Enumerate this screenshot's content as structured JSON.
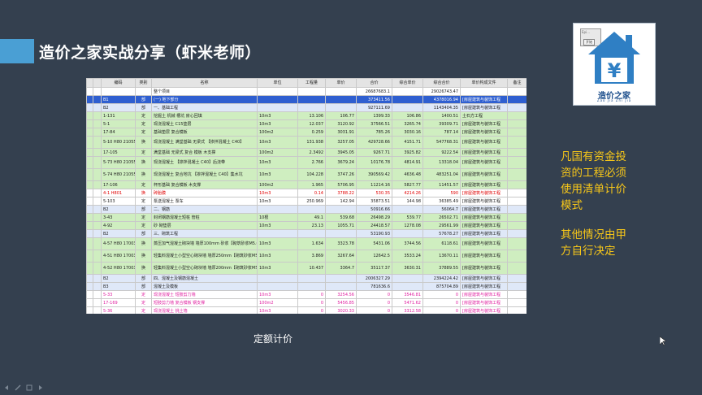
{
  "header": {
    "title": "造价之家实战分享（虾米老师）"
  },
  "table": {
    "columns": [
      "编码",
      "类别",
      "名称",
      "单位",
      "工程量",
      "单价",
      "合价",
      "综合单价",
      "综合合价",
      "单价构成文件",
      "备注"
    ],
    "rows": [
      {
        "cls": "row-white",
        "cells": [
          "",
          "",
          "整个项目",
          "",
          "",
          "",
          "26687683.1",
          "",
          "29026743.47",
          "",
          ""
        ]
      },
      {
        "cls": "row-blue",
        "cells": [
          "B1",
          "部",
          "(一) 地下部分",
          "",
          "",
          "",
          "373411.56",
          "",
          "4378016.94",
          "[房屋建筑与装饰工程",
          ""
        ]
      },
      {
        "cls": "row-lblue",
        "cells": [
          "B2",
          "部",
          "一、基础工程",
          "",
          "",
          "",
          "927111.69",
          "",
          "1143404.35",
          "[房屋建筑与装饰工程",
          ""
        ]
      },
      {
        "cls": "row-green",
        "cells": [
          "1-131",
          "定",
          "挖掘土 机械 槽坑 房心回填",
          "10m3",
          "13.106",
          "106.77",
          "1399.33",
          "106.86",
          "1400.51",
          "土石方工程",
          ""
        ]
      },
      {
        "cls": "row-green",
        "cells": [
          "5-1",
          "定",
          "现浇混凝土 C15垫层",
          "10m3",
          "12.037",
          "3120.92",
          "37566.51",
          "3265.74",
          "39309.71",
          "[房屋建筑与装饰工程",
          ""
        ]
      },
      {
        "cls": "row-green",
        "cells": [
          "17-84",
          "定",
          "基础垫层 复合模板",
          "100m2",
          "0.259",
          "3031.91",
          "785.26",
          "3030.16",
          "787.14",
          "[房屋建筑与装饰工程",
          ""
        ]
      },
      {
        "cls": "row-green row-tall",
        "cells": [
          "5-10 H80 210557 8",
          "换",
          "现浇混凝土 满堂基础 无梁式 【掺拌混凝土 C40】",
          "10m3",
          "131.938",
          "3257.05",
          "429728.66",
          "4151.71",
          "547768.31",
          "[房屋建筑与装饰工程",
          ""
        ]
      },
      {
        "cls": "row-green",
        "cells": [
          "17-105",
          "定",
          "满堂基础 无梁式 复合 模板 木支撑",
          "100m2",
          "2.3492",
          "3945.05",
          "9267.71",
          "3925.82",
          "9222.54",
          "[房屋建筑与装饰工程",
          ""
        ]
      },
      {
        "cls": "row-green row-tall",
        "cells": [
          "5-73 H80 210557 8",
          "换",
          "现浇混凝土 【掺拌混凝土 C40】后浇带",
          "10m3",
          "2.766",
          "3679.24",
          "10176.78",
          "4814.91",
          "13318.04",
          "[房屋建筑与装饰工程",
          ""
        ]
      },
      {
        "cls": "row-green row-tall",
        "cells": [
          "5-74 H80 210557 8",
          "换",
          "现浇混凝土 复合地坑 【掺拌混凝土 C40】集水坑",
          "10m3",
          "104.228",
          "3747.26",
          "390569.42",
          "4636.48",
          "483251.04",
          "[房屋建筑与装饰工程",
          ""
        ]
      },
      {
        "cls": "row-green",
        "cells": [
          "17-106",
          "定",
          "杯形基础 复合模板 木支撑",
          "100m2",
          "1.965",
          "5706.95",
          "11214.16",
          "5827.77",
          "11451.57",
          "[房屋建筑与装饰工程",
          ""
        ]
      },
      {
        "cls": "row-red",
        "cells": [
          "4-1 H801",
          "换",
          "砖胎膜",
          "10m3",
          "0.14",
          "3788.22",
          "530.35",
          "4214.26",
          "590",
          "[房屋建筑与装饰工程",
          ""
        ]
      },
      {
        "cls": "row-white",
        "cells": [
          "5-103",
          "定",
          "泵送混凝土 泵车",
          "10m3",
          "250.969",
          "142.94",
          "35873.51",
          "144.98",
          "36385.49",
          "[房屋建筑与装饰工程",
          ""
        ]
      },
      {
        "cls": "row-lblue",
        "cells": [
          "B2",
          "部",
          "二、钢筋",
          "",
          "",
          "",
          "50916.66",
          "",
          "56064.7",
          "[房屋建筑与装饰工程",
          ""
        ]
      },
      {
        "cls": "row-green",
        "cells": [
          "3-43",
          "定",
          "封闭钢筋混凝土短桩 管桩",
          "10根",
          "49.1",
          "539.68",
          "26498.29",
          "539.77",
          "26502.71",
          "[房屋建筑与装饰工程",
          ""
        ]
      },
      {
        "cls": "row-green",
        "cells": [
          "4-92",
          "定",
          "砂 砌垫层",
          "10m3",
          "23.13",
          "1055.71",
          "24418.57",
          "1278.08",
          "29561.99",
          "[房屋建筑与装饰工程",
          ""
        ]
      },
      {
        "cls": "row-lblue",
        "cells": [
          "B2",
          "部",
          "三、砌筑工程",
          "",
          "",
          "",
          "53190.93",
          "",
          "57678.27",
          "[房屋建筑与装饰工程",
          ""
        ]
      },
      {
        "cls": "row-green row-tall",
        "cells": [
          "4-57 H80 170030 8",
          "换",
          "蒸压加气混凝土砌块墙 墙厚100mm 砂浆【砌筑砂浆M5.0】",
          "10m3",
          "1.634",
          "3323.78",
          "5431.06",
          "3744.56",
          "6118.61",
          "[房屋建筑与装饰工程",
          ""
        ]
      },
      {
        "cls": "row-green row-tall",
        "cells": [
          "4-51 H80 170030 8",
          "换",
          "轻集料混凝土小型空心砌块墙 墙厚250mm【砌筑砂浆M5.0】",
          "10m3",
          "3.869",
          "3267.64",
          "12642.5",
          "3533.24",
          "13670.11",
          "[房屋建筑与装饰工程",
          ""
        ]
      },
      {
        "cls": "row-green row-tall",
        "cells": [
          "4-52 H80 170030 8",
          "换",
          "轻集料混凝土小型空心砌块墙 墙厚200mm【砌筑砂浆M5.0】",
          "10m3",
          "10.437",
          "3364.7",
          "35117.37",
          "3630.31",
          "37889.55",
          "[房屋建筑与装饰工程",
          ""
        ]
      },
      {
        "cls": "row-lblue",
        "cells": [
          "B2",
          "部",
          "四、混凝土及钢筋混凝土",
          "",
          "",
          "",
          "2006327.29",
          "",
          "2394224.42",
          "[房屋建筑与装饰工程",
          ""
        ]
      },
      {
        "cls": "row-lblue",
        "cells": [
          "B3",
          "部",
          "混凝土及模板",
          "",
          "",
          "",
          "781636.6",
          "",
          "875704.89",
          "[房屋建筑与装饰工程",
          ""
        ]
      },
      {
        "cls": "row-pink",
        "cells": [
          "5-33",
          "定",
          "现浇混凝土 短肢剪力墙",
          "10m3",
          "0",
          "3254.56",
          "0",
          "3546.81",
          "0",
          "[房屋建筑与装饰工程",
          ""
        ]
      },
      {
        "cls": "row-pink",
        "cells": [
          "17-169",
          "定",
          "短肢剪力墙 复合模板 钢支撑",
          "100m2",
          "0",
          "5456.85",
          "0",
          "5471.62",
          "0",
          "[房屋建筑与装饰工程",
          ""
        ]
      },
      {
        "cls": "row-pink",
        "cells": [
          "5-36",
          "定",
          "现浇混凝土 挑土墙",
          "10m3",
          "0",
          "3020.33",
          "0",
          "3312.58",
          "0",
          "[房屋建筑与装饰工程",
          ""
        ]
      },
      {
        "cls": "row-pink",
        "cells": [
          "17-163",
          "定",
          "挡土墙 复合模板 钢支撑",
          "100m2",
          "0",
          "5092.57",
          "0",
          "5011.31",
          "0",
          "[房屋建筑与装饰工程",
          ""
        ]
      }
    ]
  },
  "caption": "定额计价",
  "logo": {
    "window_label": "Epi...",
    "start_label": "开始",
    "name": "造价之家",
    "pinyin": "Zao Jia Zhi Jia",
    "color": "#2f7fc4"
  },
  "notes": {
    "note1": [
      "凡国有资金投",
      "资的工程必须",
      "使用清单计价",
      "模式"
    ],
    "note2": [
      "其他情况由甲",
      "方自行决定"
    ]
  },
  "colors": {
    "background": "#34404f",
    "accent": "#4a9fd4",
    "note": "#f6c619",
    "row_blue": "#2f5fd0",
    "row_green": "#cfeec0"
  }
}
